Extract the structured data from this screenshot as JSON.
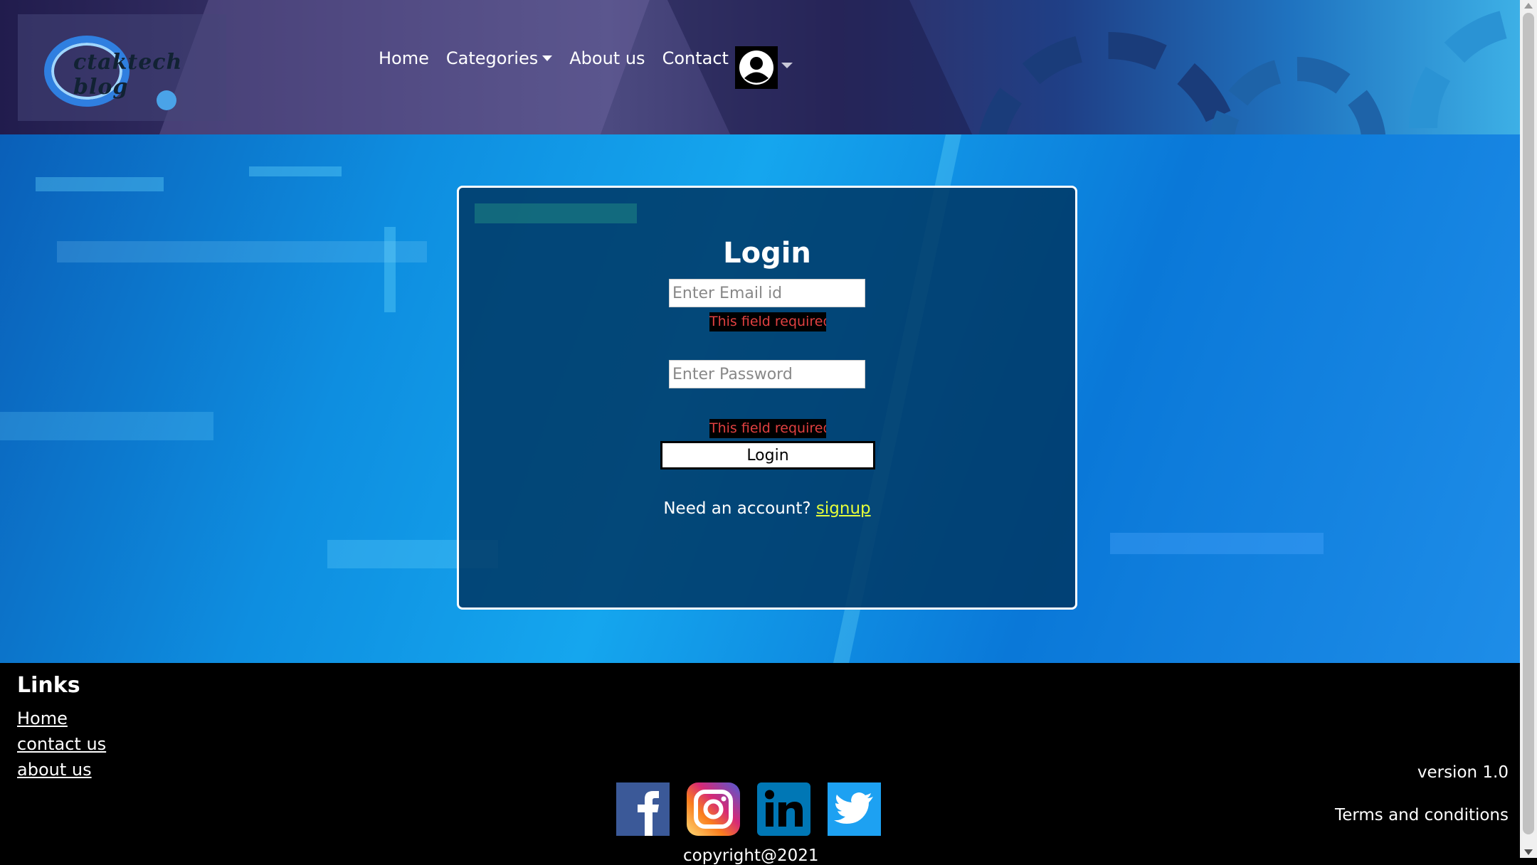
{
  "brand": {
    "logo_text": "ctaktech blog",
    "logo_icon": "gear-logo-icon"
  },
  "nav": {
    "items": [
      {
        "label": "Home"
      },
      {
        "label": "Categories",
        "has_dropdown": true
      },
      {
        "label": "About us"
      },
      {
        "label": "Contact us"
      }
    ],
    "avatar_icon": "user-avatar-icon"
  },
  "login": {
    "title": "Login",
    "email_placeholder": "Enter Email id",
    "email_value": "",
    "email_error": "This field required",
    "password_placeholder": "Enter Password",
    "password_value": "",
    "password_error": "This field required",
    "submit_label": "Login",
    "signup_prompt": "Need an account?",
    "signup_link": "signup"
  },
  "footer": {
    "links_title": "Links",
    "links": [
      {
        "label": "Home"
      },
      {
        "label": "contact us"
      },
      {
        "label": "about us"
      }
    ],
    "social": [
      {
        "name": "facebook-icon",
        "color": "#3b5998"
      },
      {
        "name": "instagram-icon",
        "color": "#e1306c"
      },
      {
        "name": "linkedin-icon",
        "color": "#0077b5"
      },
      {
        "name": "twitter-icon",
        "color": "#1da1f2"
      }
    ],
    "version": "version 1.0",
    "terms": "Terms and conditions",
    "copyright": "copyright@2021"
  },
  "colors": {
    "accent_link": "#e6ff3a",
    "error_text": "#e04040",
    "card_bg": "#003764"
  }
}
